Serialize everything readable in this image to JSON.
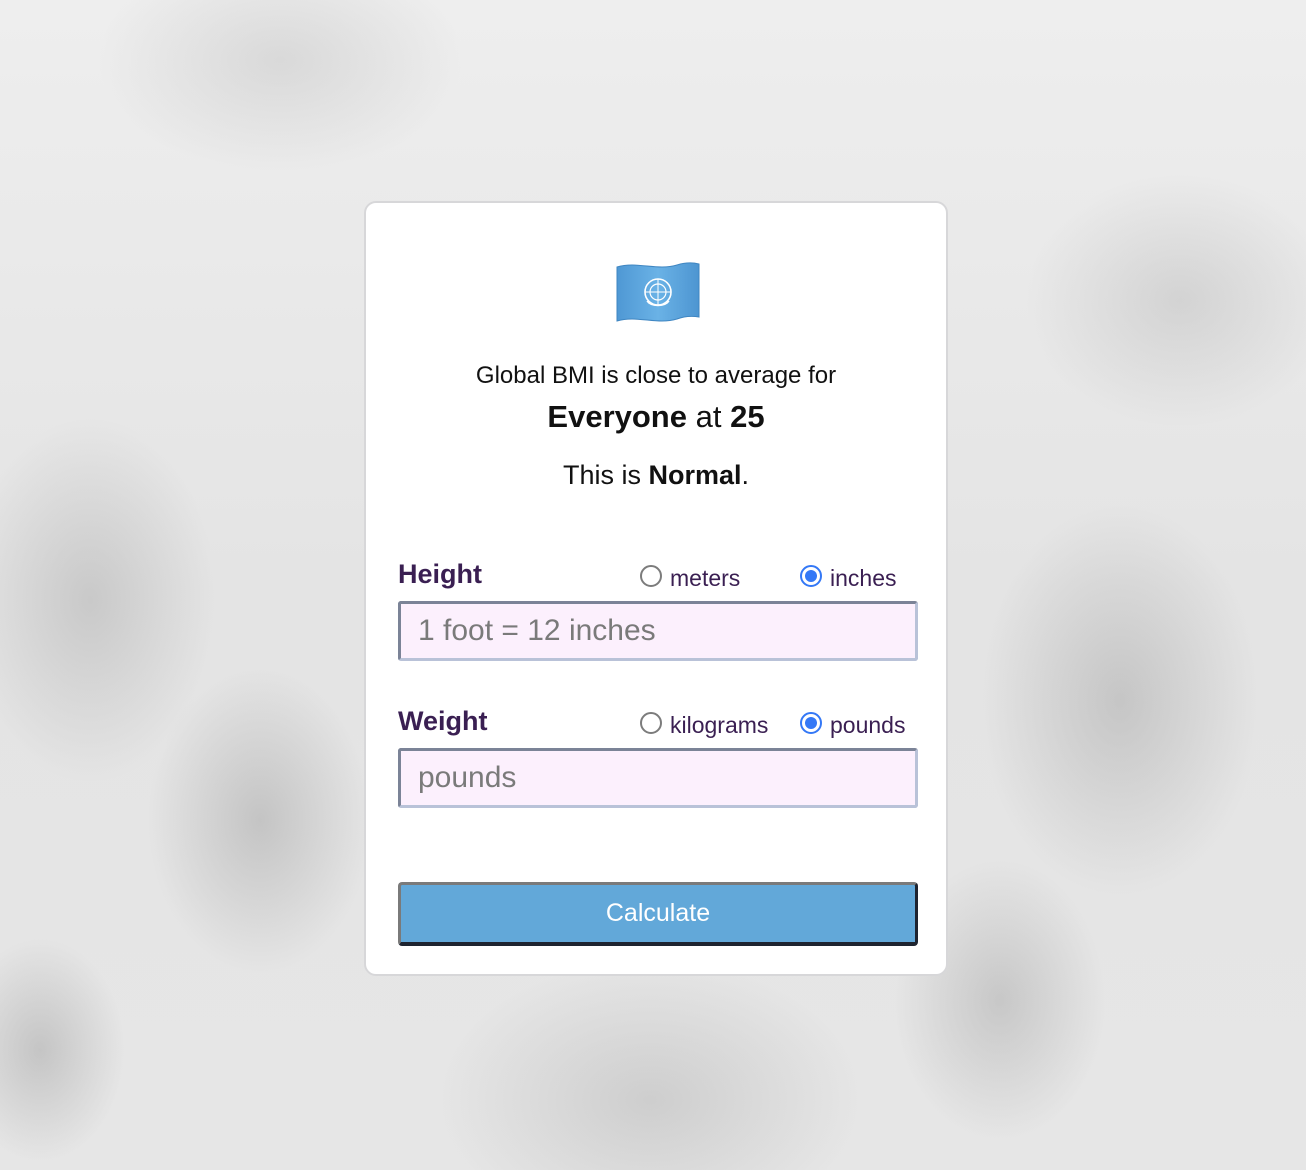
{
  "result": {
    "flag_icon": "un-flag-icon",
    "headline": "Global BMI is close to average for",
    "group": "Everyone",
    "at_word": "at",
    "bmi_value": "25",
    "category_prefix": "This is",
    "category": "Normal",
    "category_suffix": "."
  },
  "height": {
    "label": "Height",
    "units": [
      {
        "label": "meters",
        "selected": false
      },
      {
        "label": "inches",
        "selected": true
      }
    ],
    "value": "",
    "placeholder": "1 foot = 12 inches"
  },
  "weight": {
    "label": "Weight",
    "units": [
      {
        "label": "kilograms",
        "selected": false
      },
      {
        "label": "pounds",
        "selected": true
      }
    ],
    "value": "",
    "placeholder": "pounds"
  },
  "calculate_label": "Calculate",
  "colors": {
    "accent": "#62a8d9",
    "label_text": "#3a1f52",
    "input_bg": "#fcf0fd",
    "radio_selected": "#3478f6",
    "un_blue": "#5aa2dc"
  }
}
